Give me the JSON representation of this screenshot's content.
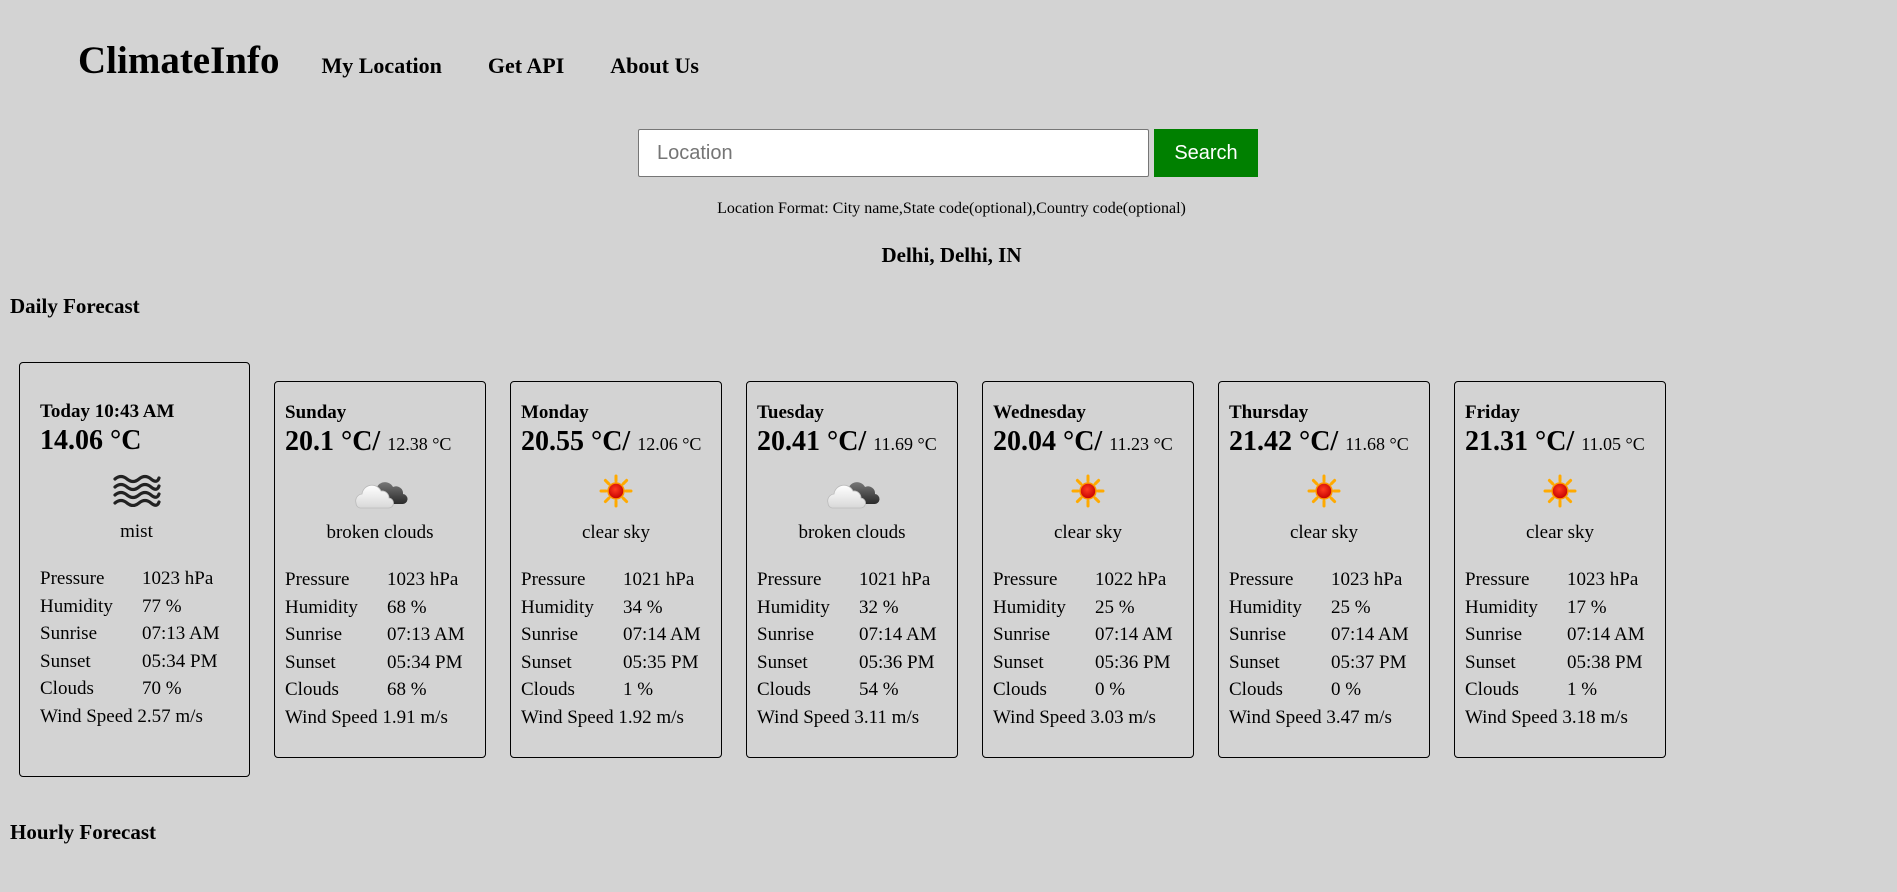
{
  "header": {
    "brand": "ClimateInfo",
    "nav": [
      "My Location",
      "Get API",
      "About Us"
    ]
  },
  "search": {
    "placeholder": "Location",
    "value": "",
    "button_label": "Search",
    "format_hint": "Location Format: City name,State code(optional),Country code(optional)"
  },
  "location": "Delhi, Delhi, IN",
  "sections": {
    "daily": "Daily Forecast",
    "hourly": "Hourly Forecast"
  },
  "labels": {
    "pressure": "Pressure",
    "humidity": "Humidity",
    "sunrise": "Sunrise",
    "sunset": "Sunset",
    "clouds": "Clouds",
    "wind_speed": "Wind Speed"
  },
  "today": {
    "day": "Today 10:43 AM",
    "temp": "14.06 °C",
    "icon": "mist-icon",
    "desc": "mist",
    "pressure": "1023 hPa",
    "humidity": "77 %",
    "sunrise": "07:13 AM",
    "sunset": "05:34 PM",
    "clouds": "70 %",
    "wind": "2.57 m/s"
  },
  "forecast": [
    {
      "day": "Sunday",
      "high": "20.1 °C/",
      "low": "12.38 °C",
      "icon": "broken-clouds-icon",
      "desc": "broken clouds",
      "pressure": "1023 hPa",
      "humidity": "68 %",
      "sunrise": "07:13 AM",
      "sunset": "05:34 PM",
      "clouds": "68 %",
      "wind": "1.91 m/s"
    },
    {
      "day": "Monday",
      "high": "20.55 °C/",
      "low": "12.06 °C",
      "icon": "sun-icon",
      "desc": "clear sky",
      "pressure": "1021 hPa",
      "humidity": "34 %",
      "sunrise": "07:14 AM",
      "sunset": "05:35 PM",
      "clouds": "1 %",
      "wind": "1.92 m/s"
    },
    {
      "day": "Tuesday",
      "high": "20.41 °C/",
      "low": "11.69 °C",
      "icon": "broken-clouds-icon",
      "desc": "broken clouds",
      "pressure": "1021 hPa",
      "humidity": "32 %",
      "sunrise": "07:14 AM",
      "sunset": "05:36 PM",
      "clouds": "54 %",
      "wind": "3.11 m/s"
    },
    {
      "day": "Wednesday",
      "high": "20.04 °C/",
      "low": "11.23 °C",
      "icon": "sun-icon",
      "desc": "clear sky",
      "pressure": "1022 hPa",
      "humidity": "25 %",
      "sunrise": "07:14 AM",
      "sunset": "05:36 PM",
      "clouds": "0 %",
      "wind": "3.03 m/s"
    },
    {
      "day": "Thursday",
      "high": "21.42 °C/",
      "low": "11.68 °C",
      "icon": "sun-icon",
      "desc": "clear sky",
      "pressure": "1023 hPa",
      "humidity": "25 %",
      "sunrise": "07:14 AM",
      "sunset": "05:37 PM",
      "clouds": "0 %",
      "wind": "3.47 m/s"
    },
    {
      "day": "Friday",
      "high": "21.31 °C/",
      "low": "11.05 °C",
      "icon": "sun-icon",
      "desc": "clear sky",
      "pressure": "1023 hPa",
      "humidity": "17 %",
      "sunrise": "07:14 AM",
      "sunset": "05:38 PM",
      "clouds": "1 %",
      "wind": "3.18 m/s"
    }
  ]
}
